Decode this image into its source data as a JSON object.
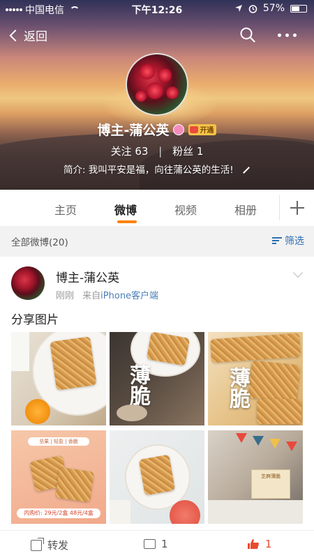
{
  "status_bar": {
    "carrier": "中国电信",
    "time": "下午12:26",
    "battery": "57%",
    "battery_level": 0.57
  },
  "nav": {
    "back_label": "返回",
    "icons": [
      "chevron-left-icon",
      "search-icon",
      "more-icon"
    ]
  },
  "profile": {
    "name": "博主-蒲公英",
    "vip_label": "开通",
    "following_label": "关注",
    "following_count": "63",
    "followers_label": "粉丝",
    "followers_count": "1",
    "bio": "简介: 我叫平安是福，向往蒲公英的生活!"
  },
  "tabs": [
    {
      "label": "主页",
      "active": false
    },
    {
      "label": "微博",
      "active": true
    },
    {
      "label": "视频",
      "active": false
    },
    {
      "label": "相册",
      "active": false
    }
  ],
  "filter": {
    "count_text": "全部微博(20)",
    "filter_label": "筛选"
  },
  "post": {
    "author": "博主-蒲公英",
    "time": "刚刚",
    "source_prefix": "来自",
    "source": "iPhone客户端",
    "text": "分享图片",
    "image_texts": {
      "t2_title": "薄脆",
      "t3_title": "薄脆",
      "t4_tag": "坚果 | 轻盈 | 香脆",
      "t4_price": "内购价: 29元/2盒 48元/4盒",
      "t6_box": "芝麻薄脆"
    },
    "actions": {
      "repost_label": "转发",
      "comment_count": "1",
      "like_count": "1"
    }
  },
  "colors": {
    "accent": "#ff8200",
    "link": "#4a7fb5",
    "filter": "#2c6fb3",
    "like": "#e84a2f"
  }
}
